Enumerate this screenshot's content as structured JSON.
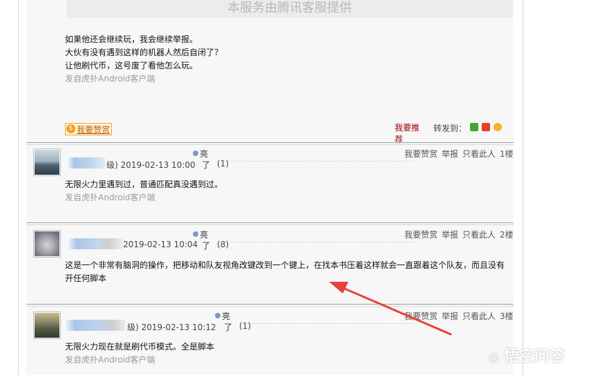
{
  "top_banner": {
    "text": "本服务由腾讯客服提供"
  },
  "op_post": {
    "lines": [
      "如果他还会继续玩，我会继续举报。",
      "大伙有没有遇到这样的机器人然后自闭了？",
      "让他刷代币，这号废了看他怎么玩。"
    ],
    "client": "发自虎扑Android客户端",
    "reward_button": "我要赞赏",
    "coin_symbol": "$",
    "recommend_label": "我要推荐",
    "forward_label": "转发到：",
    "share_icons": [
      "wechat-icon",
      "weibo-icon",
      "qzone-icon"
    ]
  },
  "replies": [
    {
      "meta_suffix": "级) 2019-02-13 10:00",
      "liang": "亮",
      "le": "了",
      "count": "(1)",
      "actions": [
        "我要赞赏",
        "举报",
        "只看此人"
      ],
      "floor": "1楼",
      "body_lines": [
        "无限火力里遇到过，普通匹配真没遇到过。"
      ],
      "client": "发自虎扑Android客户端",
      "avatar_colors": [
        "#6f8697",
        "#cbd7df"
      ]
    },
    {
      "meta_suffix": "2019-02-13 10:04",
      "liang": "亮",
      "le": "了",
      "count": "(8)",
      "actions": [
        "我要赞赏",
        "举报",
        "只看此人"
      ],
      "floor": "2楼",
      "body_lines": [
        "这是一个非常有脑洞的操作，把移动和队友视角改键改到一个键上，在找本书压着这样就会一直跟着这个队友，而且没有",
        "开任何脚本"
      ],
      "client": "",
      "avatar_colors": [
        "#8b8f98",
        "#d6d3d6"
      ]
    },
    {
      "meta_suffix": "级) 2019-02-13 10:12",
      "liang": "亮",
      "le": "了",
      "count": "(1)",
      "actions": [
        "我要赞赏",
        "举报",
        "只看此人"
      ],
      "floor": "3楼",
      "body_lines": [
        "无限火力现在就是刷代币模式。全是脚本"
      ],
      "client": "发自虎扑Android客户端",
      "avatar_colors": [
        "#4f5b45",
        "#c9b98a"
      ]
    }
  ],
  "watermark": "悟空问答",
  "colors": {
    "arrow": "#e8413a",
    "recommend": "#a00000",
    "reward": "#c05a00"
  }
}
